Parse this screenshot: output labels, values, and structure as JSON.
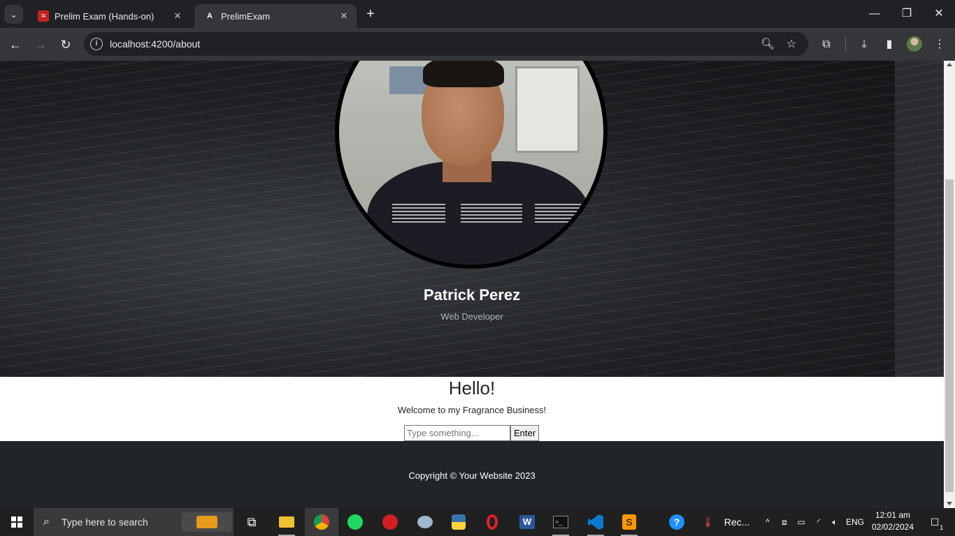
{
  "browser": {
    "tabs": [
      {
        "title": "Prelim Exam (Hands-on)",
        "favicon": "slides-icon",
        "active": false
      },
      {
        "title": "PrelimExam",
        "favicon": "angular-icon",
        "active": true
      }
    ],
    "url": "localhost:4200/about"
  },
  "profile": {
    "name": "Patrick Perez",
    "role": "Web Developer"
  },
  "intro": {
    "heading": "Hello!",
    "message": "Welcome to my Fragrance Business!",
    "input_placeholder": "Type something...",
    "button_label": "Enter"
  },
  "footer": {
    "copyright": "Copyright © Your Website 2023"
  },
  "taskbar": {
    "search_placeholder": "Type here to search",
    "pinned_label": "Rec...",
    "language": "ENG",
    "time": "12:01 am",
    "date": "02/02/2024",
    "notification_count": "1"
  },
  "colors": {
    "hero_bg": "#1e2023",
    "footer_bg": "#212529",
    "browser_frame": "#202124",
    "toolbar": "#35363a"
  }
}
